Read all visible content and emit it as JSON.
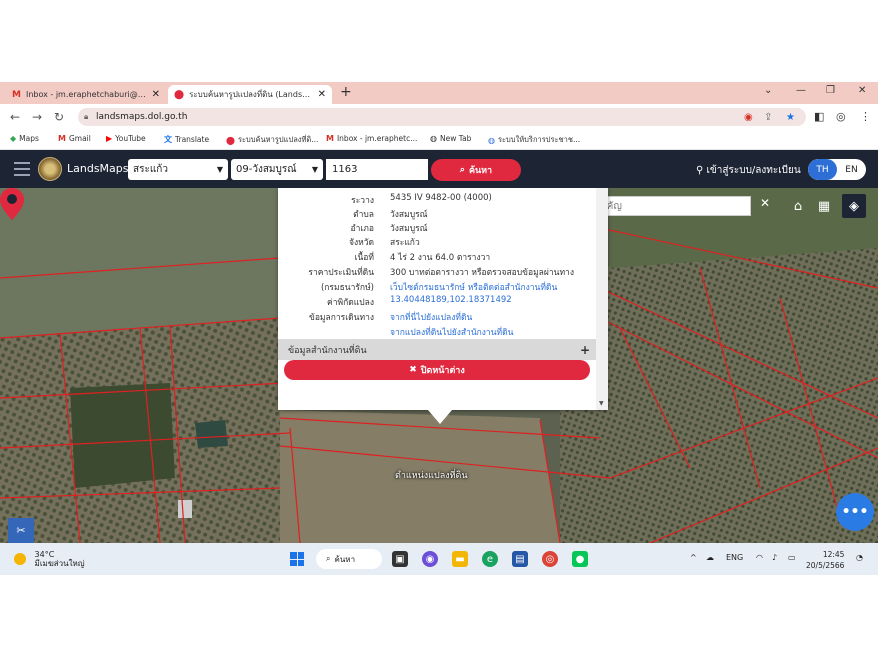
{
  "browser": {
    "tabs": [
      {
        "favicon": "M",
        "title": "Inbox - jm.eraphetchaburi@gmail.com"
      },
      {
        "favicon": "pin",
        "title": "ระบบค้นหารูปแปลงที่ดิน (LandsMaps)"
      }
    ],
    "url": "landsmaps.dol.go.th",
    "bookmarks": [
      "Maps",
      "Gmail",
      "YouTube",
      "Translate",
      "ระบบค้นหารูปแปลงที่ดิ...",
      "Inbox - jm.eraphetc...",
      "New Tab",
      "ระบบให้บริการประชาช..."
    ]
  },
  "app": {
    "brand": "LandsMaps",
    "province": "สระแก้ว",
    "district": "09-วังสมบูรณ์",
    "parcel_number": "1163",
    "search_label": "ค้นหา",
    "login_label": "เข้าสู่ระบบ/ลงทะเบียน",
    "lang_th": "TH",
    "lang_en": "EN"
  },
  "map": {
    "place_search_placeholder": "ค้นหาสถานที่สำคัญ",
    "marker_label": "ตำแหน่งแปลงที่ดิน"
  },
  "popup": {
    "rows": [
      {
        "k": "ระวาง",
        "v": "5435 IV 9482-00 (4000)"
      },
      {
        "k": "ตำบล",
        "v": "วังสมบูรณ์"
      },
      {
        "k": "อำเภอ",
        "v": "วังสมบูรณ์"
      },
      {
        "k": "จังหวัด",
        "v": "สระแก้ว"
      },
      {
        "k": "เนื้อที่",
        "v": "4 ไร่ 2 งาน 64.0 ตารางวา"
      },
      {
        "k": "ราคาประเมินที่ดิน",
        "v": "300 บาทต่อตารางวา หรือตรวจสอบข้อมูลผ่านทาง"
      },
      {
        "k": "(กรมธนารักษ์)",
        "v": "เว็บไซต์กรมธนารักษ์ หรือติดต่อสำนักงานที่ดิน"
      },
      {
        "k": "ค่าพิกัดแปลง",
        "v": "13.40448189,102.18371492"
      },
      {
        "k": "ข้อมูลการเดินทาง",
        "v": "จากที่นี่ไปยังแปลงที่ดิน"
      },
      {
        "k": "",
        "v": "จากแปลงที่ดินไปยังสำนักงานที่ดิน"
      }
    ],
    "office_info": "ข้อมูลสำนักงานที่ดิน",
    "close_label": "ปิดหน้าต่าง"
  },
  "taskbar": {
    "temperature": "34°C",
    "weather_desc": "มีเมฆส่วนใหญ่",
    "search": "ค้นหา",
    "lang": "ENG",
    "time": "12:45",
    "date": "20/5/2566"
  }
}
